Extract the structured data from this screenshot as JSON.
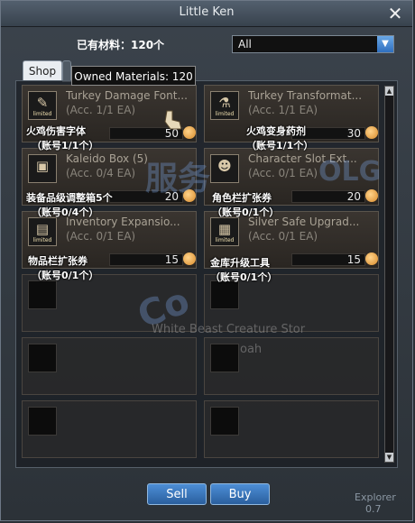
{
  "window": {
    "title": "Little Ken"
  },
  "owned_top": "已有材料：120个",
  "filter": {
    "value": "All"
  },
  "tabs": {
    "shop": "Shop"
  },
  "tooltip": "Owned Materials: 120",
  "items": [
    {
      "name": "Turkey Damage Font...",
      "sub": "(Acc. 1/1 EA)",
      "price": "50",
      "icon": "font-scroll-icon",
      "limited": "limited",
      "cn1": "火鸡伤害字体",
      "cn2": "（账号1/1个）"
    },
    {
      "name": "Turkey Transformat...",
      "sub": "(Acc. 1/1 EA)",
      "price": "30",
      "icon": "potion-icon",
      "limited": "limited",
      "cn1": "火鸡变身药剂",
      "cn2": "（账号1/1个）"
    },
    {
      "name": "Kaleido Box (5)",
      "sub": "(Acc. 0/4 EA)",
      "price": "20",
      "icon": "kaleido-box-icon",
      "limited": "",
      "cn1": "装备品级调整箱5个",
      "cn2": "（账号0/4个）"
    },
    {
      "name": "Character Slot Ext...",
      "sub": "(Acc. 0/1 EA)",
      "price": "20",
      "icon": "character-icon",
      "limited": "",
      "cn1": "角色栏扩张券",
      "cn2": "（账号0/1个）"
    },
    {
      "name": "Inventory Expansio...",
      "sub": "(Acc. 0/1 EA)",
      "price": "15",
      "icon": "inventory-icon",
      "limited": "limited",
      "cn1": "物品栏扩张券",
      "cn2": "（账号0/1个）"
    },
    {
      "name": "Silver Safe Upgrad...",
      "sub": "(Acc. 0/1 EA)",
      "price": "15",
      "icon": "safe-icon",
      "limited": "limited",
      "cn1": "金库升级工具",
      "cn2": "（账号0/1个）"
    }
  ],
  "buttons": {
    "sell": "Sell",
    "buy": "Buy"
  },
  "explorer": {
    "label": "Explorer",
    "value": "0.7"
  },
  "background_text": {
    "line1": "White Beast Creature Stor",
    "line2": "oah"
  },
  "watermark": {
    "a": "服务",
    "b": "OLG",
    "c": "Co"
  }
}
